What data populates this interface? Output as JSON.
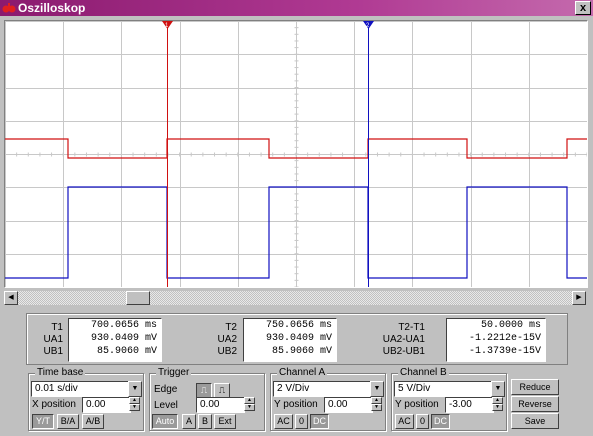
{
  "window": {
    "title": "Oszilloskop",
    "close_glyph": "x"
  },
  "icons": {
    "app": "oscilloscope-icon",
    "close": "close-icon"
  },
  "colors": {
    "title_bar": "#8b1a6f",
    "channel_a": "#d01010",
    "channel_b": "#1010c0",
    "grid": "#c8c8c8"
  },
  "cursors": {
    "t1_label": "1",
    "t2_label": "2"
  },
  "measurements": {
    "col1": {
      "labels": [
        "T1",
        "UA1",
        "UB1"
      ],
      "values": [
        "700.0656 ms",
        "930.0409 mV",
        "85.9060 mV"
      ]
    },
    "col2": {
      "labels": [
        "T2",
        "UA2",
        "UB2"
      ],
      "values": [
        "750.0656 ms",
        "930.0409 mV",
        "85.9060 mV"
      ]
    },
    "col3": {
      "labels": [
        "T2-T1",
        "UA2-UA1",
        "UB2-UB1"
      ],
      "values": [
        "50.0000 ms",
        "-1.2212e-15V",
        "-1.3739e-15V"
      ]
    }
  },
  "timebase": {
    "title": "Time base",
    "value": "0.01 s/div",
    "xpos_label": "X position",
    "xpos_value": "0.00",
    "buttons": [
      "Y/T",
      "B/A",
      "A/B"
    ],
    "selected": "Y/T"
  },
  "trigger": {
    "title": "Trigger",
    "edge_label": "Edge",
    "edge_selected": "rising",
    "level_label": "Level",
    "level_value": "0.00",
    "buttons": [
      "Auto",
      "A",
      "B",
      "Ext"
    ],
    "selected": "Auto"
  },
  "channel_a": {
    "title": "Channel A",
    "value": "2 V/Div",
    "ypos_label": "Y position",
    "ypos_value": "0.00",
    "buttons": [
      "AC",
      "0",
      "DC"
    ],
    "selected": "DC"
  },
  "channel_b": {
    "title": "Channel B",
    "value": "5 V/Div",
    "ypos_label": "Y position",
    "ypos_value": "-3.00",
    "buttons": [
      "AC",
      "0",
      "DC"
    ],
    "selected": "DC"
  },
  "actions": {
    "reduce": "Reduce",
    "reverse": "Reverse",
    "save": "Save"
  }
}
